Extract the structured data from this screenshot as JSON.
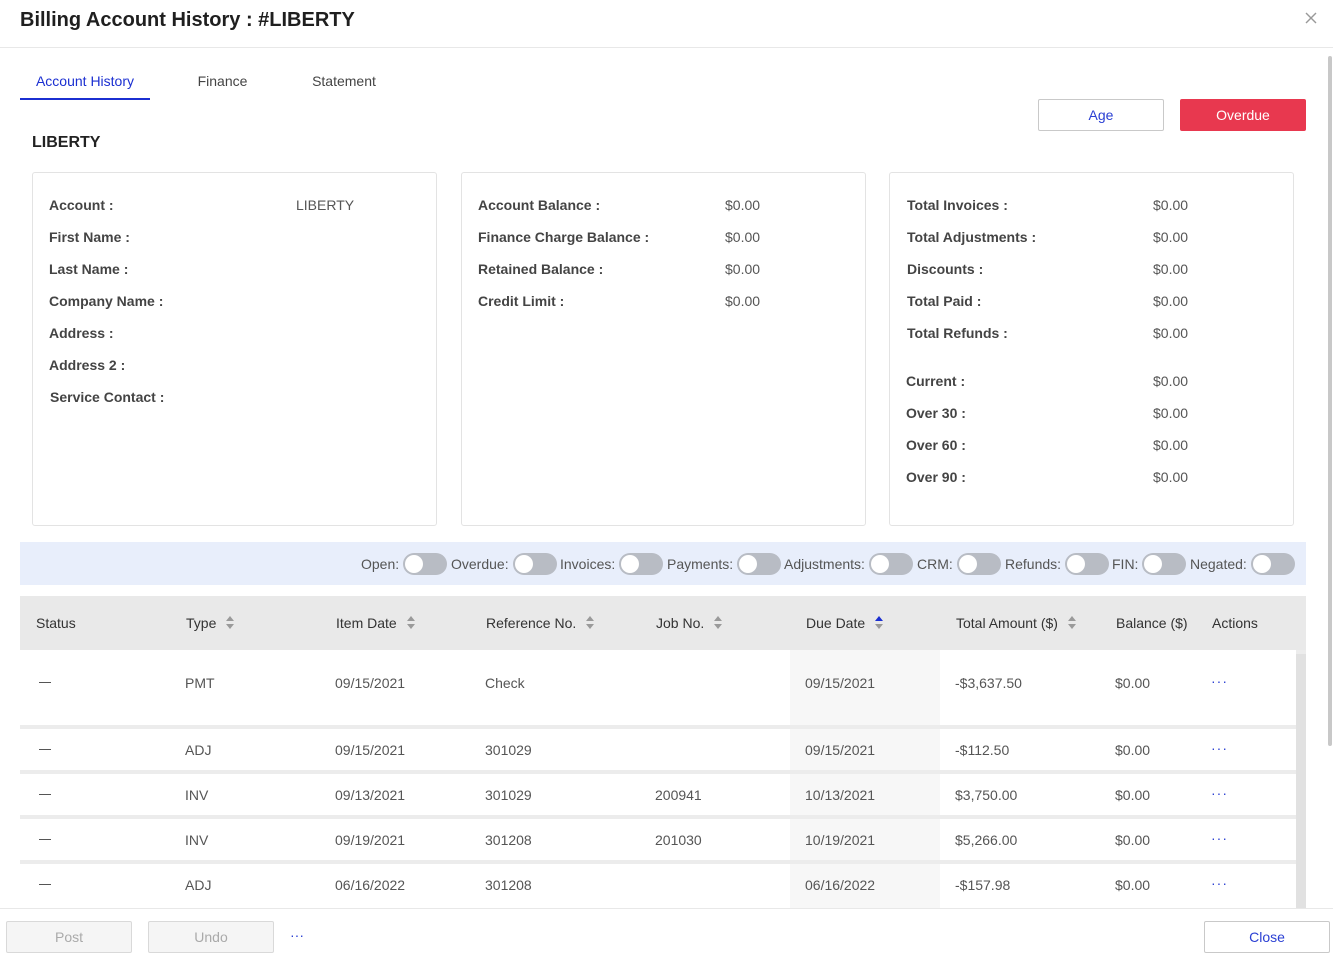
{
  "header": {
    "title": "Billing Account History : #LIBERTY"
  },
  "tabs": [
    {
      "label": "Account History",
      "active": true
    },
    {
      "label": "Finance",
      "active": false
    },
    {
      "label": "Statement",
      "active": false
    }
  ],
  "actions": {
    "age_label": "Age",
    "overdue_label": "Overdue"
  },
  "account_name": "LIBERTY",
  "account_info": [
    {
      "label": "Account :",
      "value": "LIBERTY"
    },
    {
      "label": "First Name :",
      "value": ""
    },
    {
      "label": "Last Name :",
      "value": ""
    },
    {
      "label": "Company Name :",
      "value": ""
    },
    {
      "label": "Address :",
      "value": ""
    },
    {
      "label": "Address 2 :",
      "value": ""
    },
    {
      "label": "Service Contact :",
      "value": ""
    }
  ],
  "balances": [
    {
      "label": "Account Balance :",
      "value": "$0.00"
    },
    {
      "label": "Finance Charge Balance :",
      "value": "$0.00"
    },
    {
      "label": "Retained Balance :",
      "value": "$0.00"
    },
    {
      "label": "Credit Limit :",
      "value": "$0.00"
    }
  ],
  "totals": [
    {
      "label": "Total Invoices :",
      "value": "$0.00"
    },
    {
      "label": "Total Adjustments :",
      "value": "$0.00"
    },
    {
      "label": "Discounts :",
      "value": "$0.00"
    },
    {
      "label": "Total Paid :",
      "value": "$0.00"
    },
    {
      "label": "Total Refunds :",
      "value": "$0.00"
    }
  ],
  "aging": [
    {
      "label": "Current :",
      "value": "$0.00"
    },
    {
      "label": "Over 30 :",
      "value": "$0.00"
    },
    {
      "label": "Over 60 :",
      "value": "$0.00"
    },
    {
      "label": "Over 90 :",
      "value": "$0.00"
    }
  ],
  "filters": [
    {
      "label": "Open:",
      "on": false
    },
    {
      "label": "Overdue:",
      "on": false
    },
    {
      "label": "Invoices:",
      "on": false
    },
    {
      "label": "Payments:",
      "on": false
    },
    {
      "label": "Adjustments:",
      "on": false
    },
    {
      "label": "CRM:",
      "on": false
    },
    {
      "label": "Refunds:",
      "on": false
    },
    {
      "label": "FIN:",
      "on": false
    },
    {
      "label": "Negated:",
      "on": false
    }
  ],
  "table": {
    "columns": [
      {
        "label": "Status",
        "sortable": false,
        "sorted": ""
      },
      {
        "label": "Type",
        "sortable": true,
        "sorted": ""
      },
      {
        "label": "Item Date",
        "sortable": true,
        "sorted": ""
      },
      {
        "label": "Reference No.",
        "sortable": true,
        "sorted": ""
      },
      {
        "label": "Job No.",
        "sortable": true,
        "sorted": ""
      },
      {
        "label": "Due Date",
        "sortable": true,
        "sorted": "asc"
      },
      {
        "label": "Total Amount ($)",
        "sortable": true,
        "sorted": ""
      },
      {
        "label": "Balance ($)",
        "sortable": false,
        "sorted": ""
      },
      {
        "label": "Actions",
        "sortable": false,
        "sorted": ""
      }
    ],
    "rows": [
      {
        "status": "—",
        "type": "PMT",
        "item_date": "09/15/2021",
        "reference": "Check",
        "job": "",
        "due_date": "09/15/2021",
        "total": "-$3,637.50",
        "balance": "$0.00",
        "actions": "···"
      },
      {
        "status": "—",
        "type": "ADJ",
        "item_date": "09/15/2021",
        "reference": "301029",
        "job": "",
        "due_date": "09/15/2021",
        "total": "-$112.50",
        "balance": "$0.00",
        "actions": "···"
      },
      {
        "status": "—",
        "type": "INV",
        "item_date": "09/13/2021",
        "reference": "301029",
        "job": "200941",
        "due_date": "10/13/2021",
        "total": "$3,750.00",
        "balance": "$0.00",
        "actions": "···"
      },
      {
        "status": "—",
        "type": "INV",
        "item_date": "09/19/2021",
        "reference": "301208",
        "job": "201030",
        "due_date": "10/19/2021",
        "total": "$5,266.00",
        "balance": "$0.00",
        "actions": "···"
      },
      {
        "status": "—",
        "type": "ADJ",
        "item_date": "06/16/2022",
        "reference": "301208",
        "job": "",
        "due_date": "06/16/2022",
        "total": "-$157.98",
        "balance": "$0.00",
        "actions": "···"
      }
    ]
  },
  "footer": {
    "post_label": "Post",
    "undo_label": "Undo",
    "more_label": "···",
    "close_label": "Close"
  }
}
